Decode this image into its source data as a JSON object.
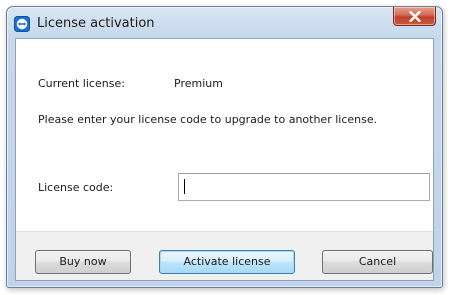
{
  "window": {
    "title": "License activation",
    "icon": "teamviewer-app-icon",
    "close_icon": "close-icon"
  },
  "license": {
    "current_label": "Current license:",
    "current_value": "Premium",
    "instructions": "Please enter your license code to upgrade to another license.",
    "code_label": "License code:",
    "code_value": "",
    "code_placeholder": ""
  },
  "buttons": {
    "buy_now": "Buy now",
    "activate": "Activate license",
    "cancel": "Cancel"
  },
  "colors": {
    "close_button": "#c95a3e",
    "default_button_border": "#3c7fb1",
    "app_icon": "#1f6fd1"
  }
}
